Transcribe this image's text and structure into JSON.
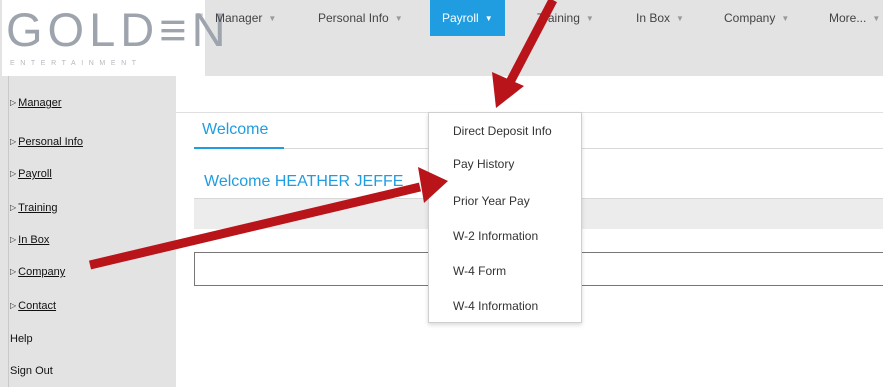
{
  "logo": {
    "word": "GOLD≡N",
    "tm": "™",
    "sub": "ENTERTAINMENT"
  },
  "sidebar": {
    "items": [
      {
        "label": "Manager"
      },
      {
        "label": "Personal Info"
      },
      {
        "label": "Payroll"
      },
      {
        "label": "Training"
      },
      {
        "label": "In Box"
      },
      {
        "label": "Company"
      },
      {
        "label": "Contact"
      },
      {
        "label": "Help"
      },
      {
        "label": "Sign Out"
      }
    ]
  },
  "topnav": {
    "items": [
      {
        "label": "Manager"
      },
      {
        "label": "Personal Info"
      },
      {
        "label": "Payroll"
      },
      {
        "label": "Training"
      },
      {
        "label": "In Box"
      },
      {
        "label": "Company"
      },
      {
        "label": "More..."
      }
    ]
  },
  "main": {
    "tab": "Welcome",
    "welcome_message": "Welcome  HEATHER JEFFE"
  },
  "dropdown": {
    "items": [
      {
        "label": "Direct Deposit Info"
      },
      {
        "label": "Pay History"
      },
      {
        "label": "Prior Year Pay"
      },
      {
        "label": "W-2 Information"
      },
      {
        "label": "W-4 Form"
      },
      {
        "label": "W-4 Information"
      }
    ]
  },
  "colors": {
    "accent": "#1f9de0",
    "arrow": "#b8141a",
    "chrome": "#e3e3e3"
  }
}
